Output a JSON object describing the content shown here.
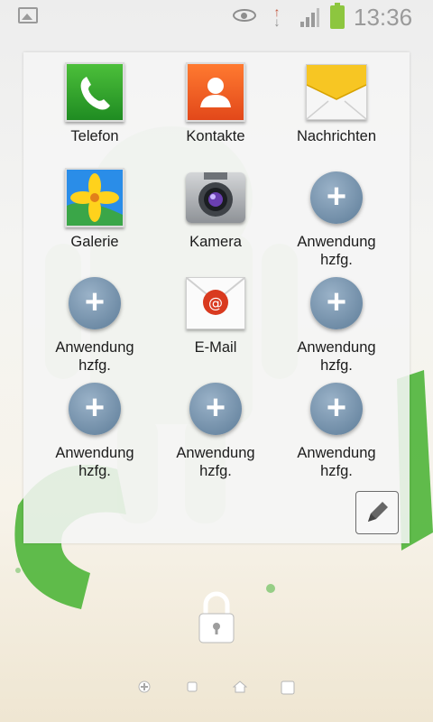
{
  "status_bar": {
    "time": "13:36",
    "icons": [
      "gallery-icon",
      "eye-icon",
      "data-transfer-icon",
      "signal-icon",
      "battery-icon"
    ],
    "battery_color": "#8dc63f"
  },
  "apps": [
    {
      "label": "Telefon",
      "icon": "phone-icon"
    },
    {
      "label": "Kontakte",
      "icon": "contacts-icon"
    },
    {
      "label": "Nachrichten",
      "icon": "messages-icon"
    },
    {
      "label": "Galerie",
      "icon": "gallery-app-icon"
    },
    {
      "label": "Kamera",
      "icon": "camera-icon"
    },
    {
      "label": "Anwendung\nhzfg.",
      "icon": "add-icon"
    },
    {
      "label": "Anwendung\nhzfg.",
      "icon": "add-icon"
    },
    {
      "label": "E-Mail",
      "icon": "email-icon"
    },
    {
      "label": "Anwendung\nhzfg.",
      "icon": "add-icon"
    },
    {
      "label": "Anwendung\nhzfg.",
      "icon": "add-icon"
    },
    {
      "label": "Anwendung\nhzfg.",
      "icon": "add-icon"
    },
    {
      "label": "Anwendung\nhzfg.",
      "icon": "add-icon"
    }
  ],
  "actions": {
    "edit_icon": "pencil-icon",
    "lock_icon": "lock-icon"
  },
  "navigation": {
    "items": [
      "settings-dot-icon",
      "square-dot-icon",
      "home-dot-icon",
      "recent-square-icon"
    ]
  },
  "colors": {
    "phone": "#2aa12d",
    "contacts": "#f1602a",
    "add_button": "#6f8fab"
  }
}
